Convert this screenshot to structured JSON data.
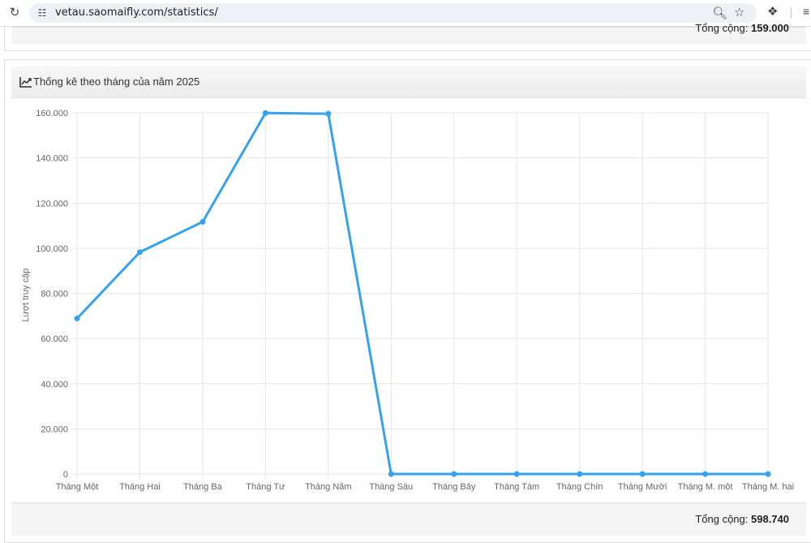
{
  "browser": {
    "url": "vetau.saomaifly.com/statistics/"
  },
  "top_card": {
    "total_label": "Tổng cộng:",
    "total_value": "159.000"
  },
  "card": {
    "title": "Thống kê theo tháng của năm 2025",
    "total_label": "Tổng cộng:",
    "total_value": "598.740"
  },
  "chart_data": {
    "type": "line",
    "ylabel": "Lượt truy cập",
    "xlabel": "",
    "ylim": [
      0,
      160000
    ],
    "yticks": [
      "0",
      "20.000",
      "40.000",
      "60.000",
      "80.000",
      "100.000",
      "120.000",
      "140.000",
      "160.000"
    ],
    "grid": true,
    "categories": [
      "Tháng Một",
      "Tháng Hai",
      "Tháng Ba",
      "Tháng Tư",
      "Tháng Năm",
      "Tháng Sáu",
      "Tháng Bảy",
      "Tháng Tám",
      "Tháng Chín",
      "Tháng Mười",
      "Tháng M. một",
      "Tháng M. hai"
    ],
    "series": [
      {
        "values": [
          68900,
          98300,
          111700,
          159900,
          159600,
          0,
          0,
          0,
          0,
          0,
          0,
          0
        ],
        "color": "#36a2eb"
      }
    ]
  }
}
